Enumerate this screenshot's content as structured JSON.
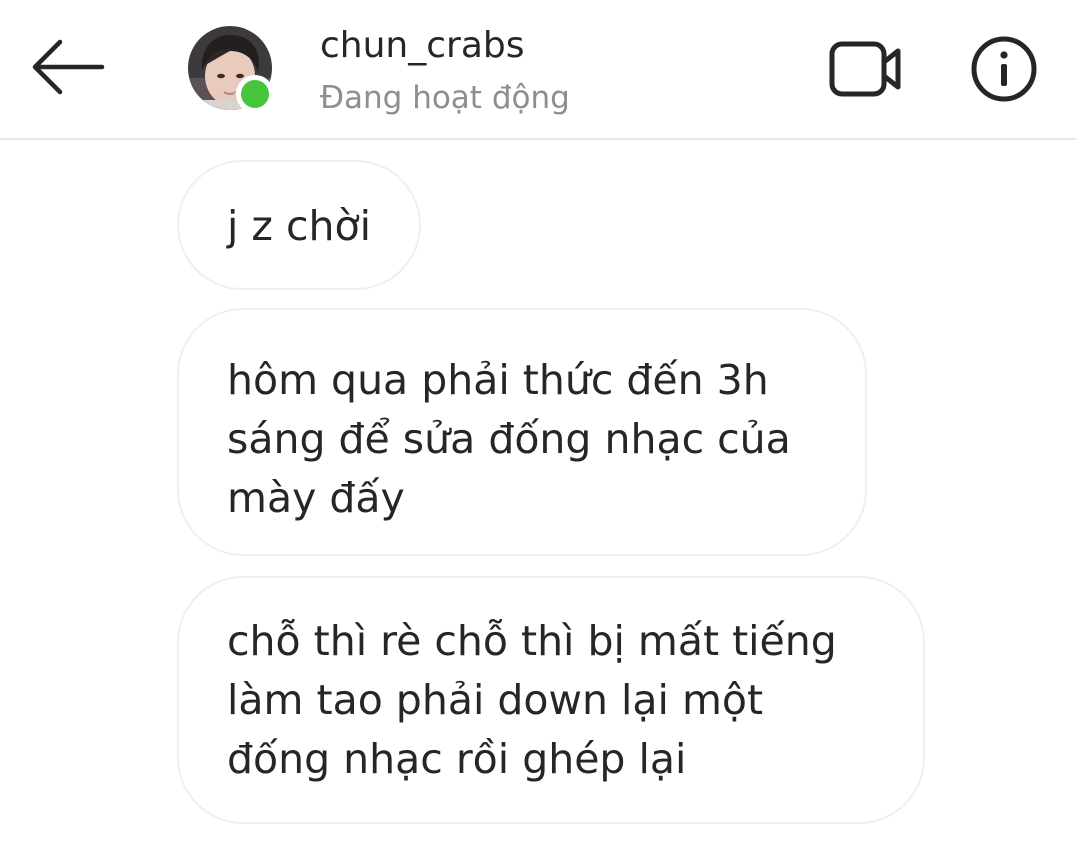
{
  "header": {
    "username": "chun_crabs",
    "status": "Đang hoạt động"
  },
  "icons": {
    "back": "arrow-left-icon",
    "video": "video-camera-icon",
    "info": "info-icon"
  },
  "colors": {
    "online": "#47c63c",
    "text": "#262626",
    "muted": "#8e8e8e",
    "bubble_border": "#efefef"
  },
  "messages": [
    {
      "lines": [
        "j z chời"
      ]
    },
    {
      "lines": [
        "hôm qua phải thức đến 3h",
        "sáng để sửa đống nhạc của",
        "mày đấy"
      ]
    },
    {
      "lines": [
        "chỗ thì rè chỗ thì bị mất tiếng",
        "làm tao phải down lại một",
        "đống nhạc rồi ghép lại"
      ]
    }
  ]
}
